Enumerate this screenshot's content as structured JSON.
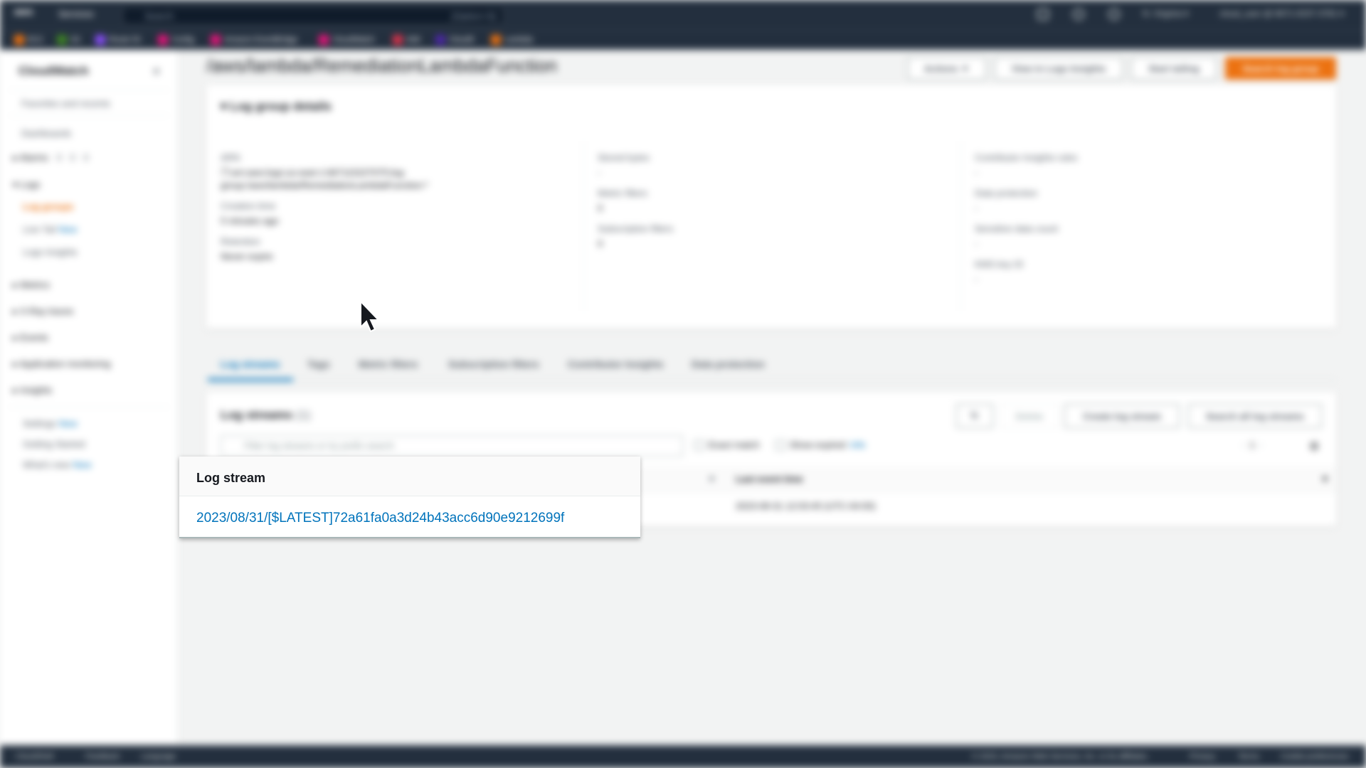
{
  "topnav": {
    "logo": "aws",
    "services_label": "Services",
    "search_placeholder": "Search",
    "search_shortcut": "[Option+S]",
    "region": "N. Virginia ▾",
    "account": "cloud_user @ 6671-0237-3781 ▾"
  },
  "favorites": [
    {
      "label": "EC2",
      "color": "#ec7211"
    },
    {
      "label": "S3",
      "color": "#3f8624"
    },
    {
      "label": "Route 53",
      "color": "#8c4fff"
    },
    {
      "label": "Config",
      "color": "#e7157b"
    },
    {
      "label": "Amazon EventBridge",
      "color": "#e7157b"
    },
    {
      "label": "CloudWatch",
      "color": "#e7157b"
    },
    {
      "label": "IAM",
      "color": "#dd344c"
    },
    {
      "label": "Cloud9",
      "color": "#4d27aa"
    },
    {
      "label": "Lambda",
      "color": "#ec7211"
    }
  ],
  "sidebar": {
    "title": "CloudWatch",
    "favorites_recents": "Favorites and recents",
    "dashboards": "Dashboards",
    "alarms": "Alarms",
    "alarm_counts": [
      "0",
      "0",
      "0"
    ],
    "logs": "Logs",
    "log_groups": "Log groups",
    "live_tail": "Live Tail",
    "new_badge": "New",
    "logs_insights": "Logs Insights",
    "metrics": "Metrics",
    "xray": "X-Ray traces",
    "events": "Events",
    "app_monitoring": "Application monitoring",
    "insights": "Insights",
    "settings": "Settings",
    "getting_started": "Getting Started",
    "whats_new": "What's new"
  },
  "page": {
    "title": "/aws/lambda/RemediationLambdaFunction",
    "actions": "Actions ▼",
    "view_insights": "View in Logs Insights",
    "start_tailing": "Start tailing",
    "search_log_group": "Search log group"
  },
  "details": {
    "heading": "Log group details",
    "arn_label": "ARN",
    "arn_line1": "arn:aws:logs:us-east-1:667115227075:log-",
    "arn_line2": "group:/aws/lambda/RemediationLambdaFunction:*",
    "creation_label": "Creation time",
    "creation_value": "5 minutes ago",
    "retention_label": "Retention",
    "retention_value": "Never expire",
    "stored_label": "Stored bytes",
    "stored_value": "-",
    "metric_label": "Metric filters",
    "metric_value": "0",
    "sub_label": "Subscription filters",
    "sub_value": "0",
    "contrib_label": "Contributor Insights rules",
    "contrib_value": "-",
    "dataprot_label": "Data protection",
    "dataprot_value": "-",
    "sensitive_label": "Sensitive data count",
    "sensitive_value": "-",
    "kms_label": "KMS key ID",
    "kms_value": "-"
  },
  "tabs": [
    "Log streams",
    "Tags",
    "Metric filters",
    "Subscription filters",
    "Contributor Insights",
    "Data protection"
  ],
  "streams": {
    "heading": "Log streams",
    "count": "(1)",
    "delete": "Delete",
    "create": "Create log stream",
    "search_all": "Search all log streams",
    "filter_placeholder": "Filter log streams or try prefix search",
    "exact_match": "Exact match",
    "show_expired": "Show expired",
    "info": "Info",
    "page_num": "1",
    "col_last_event": "Last event time",
    "last_event_value": "2023-08-31 12:03:45 (UTC-04:00)"
  },
  "popup": {
    "heading": "Log stream",
    "stream_name": "2023/08/31/[$LATEST]72a61fa0a3d24b43acc6d90e9212699f"
  },
  "footer": {
    "cloudshell": "CloudShell",
    "feedback": "Feedback",
    "language": "Language",
    "copyright": "© 2023, Amazon Web Services, Inc. or its affiliates.",
    "privacy": "Privacy",
    "terms": "Terms",
    "cookies": "Cookie preferences"
  }
}
